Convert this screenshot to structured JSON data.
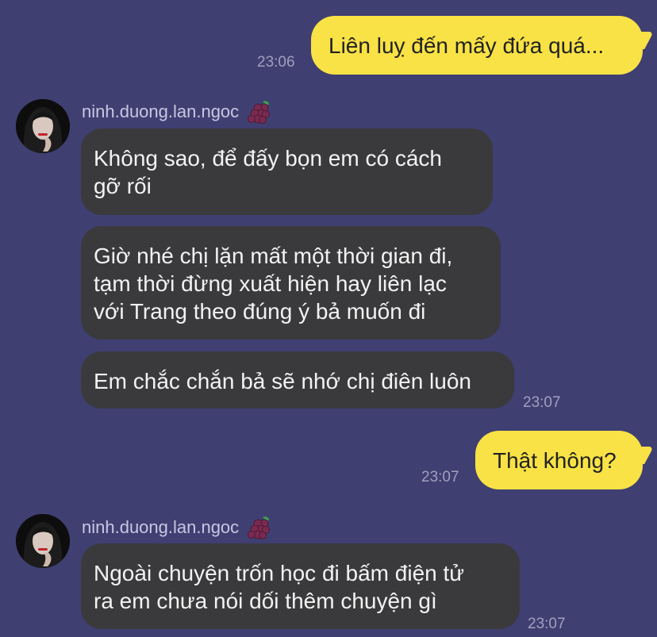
{
  "conversation": {
    "messages": [
      {
        "id": "m1",
        "type": "outgoing",
        "text": "Liên luỵ đến mấy đứa quá...",
        "time": "23:06"
      },
      {
        "id": "m2",
        "type": "incoming",
        "sender": "ninh.duong.lan.ngoc",
        "sender_emoji": "grapes-icon",
        "text": "Không sao, để đấy bọn em có cách\ngỡ rối"
      },
      {
        "id": "m3",
        "type": "incoming",
        "text": "Giờ nhé chị lặn mất một thời gian đi,\ntạm thời đừng xuất hiện hay liên lạc\nvới Trang theo đúng ý bả muốn đi"
      },
      {
        "id": "m4",
        "type": "incoming",
        "text": "Em chắc chắn bả sẽ nhớ chị điên luôn",
        "time": "23:07"
      },
      {
        "id": "m5",
        "type": "outgoing",
        "text": "Thật không?",
        "time": "23:07"
      },
      {
        "id": "m6",
        "type": "incoming",
        "sender": "ninh.duong.lan.ngoc",
        "sender_emoji": "grapes-icon",
        "text": "Ngoài chuyện trốn học đi bấm điện tử\nra em chưa nói dối thêm chuyện gì",
        "time": "23:07"
      }
    ]
  },
  "colors": {
    "background": "#3f3f72",
    "outgoing_bubble": "#f9e245",
    "incoming_bubble": "#3a3a3c"
  }
}
